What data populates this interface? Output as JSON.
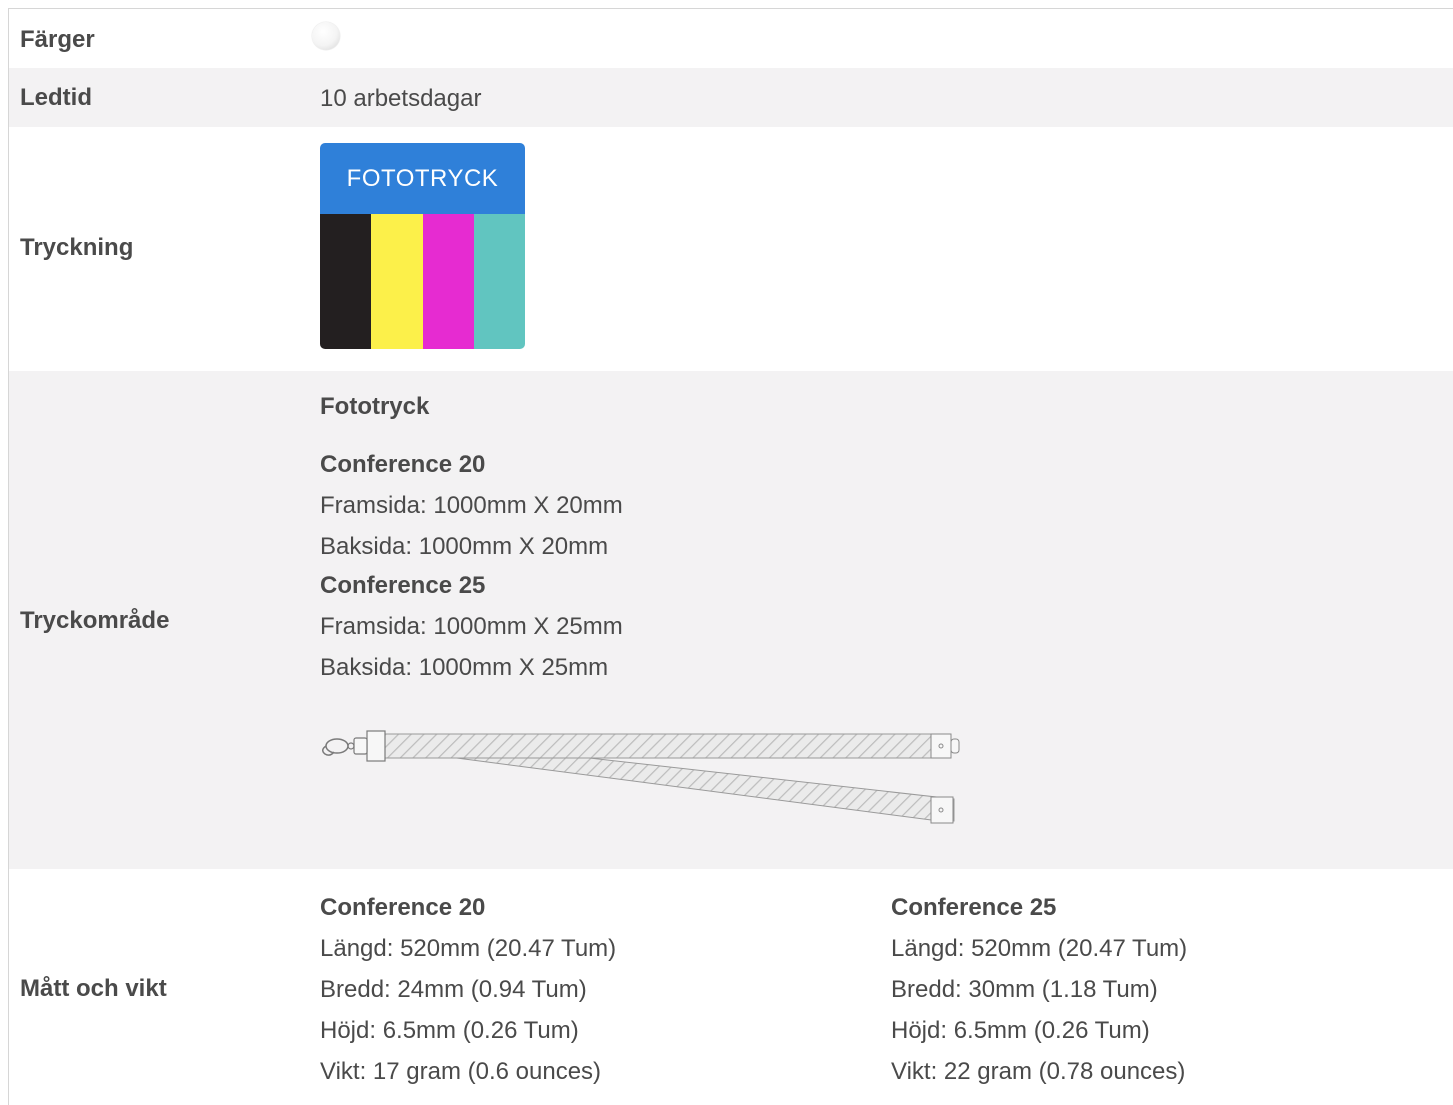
{
  "rows": {
    "colors": {
      "label": "Färger",
      "swatch_color": "#f4f4f4"
    },
    "lead_time": {
      "label": "Ledtid",
      "value": "10 arbetsdagar"
    },
    "printing": {
      "label": "Tryckning",
      "badge_title": "FOTOTRYCK",
      "badge_header_color": "#2f80d9",
      "bar_colors": [
        "#231f20",
        "#fcf04a",
        "#e62bd1",
        "#61c5c0"
      ]
    },
    "print_area": {
      "label": "Tryckområde",
      "method": "Fototryck",
      "models": [
        {
          "name": "Conference 20",
          "front": "Framsida: 1000mm X 20mm",
          "back": "Baksida: 1000mm X 20mm"
        },
        {
          "name": "Conference 25",
          "front": "Framsida: 1000mm X 25mm",
          "back": "Baksida: 1000mm X 25mm"
        }
      ],
      "image": "lanyard-illustration"
    },
    "dimensions": {
      "label": "Mått och vikt",
      "models": [
        {
          "name": "Conference 20",
          "length": "Längd: 520mm (20.47 Tum)",
          "width": "Bredd: 24mm (0.94 Tum)",
          "height": "Höjd: 6.5mm (0.26 Tum)",
          "weight": "Vikt: 17 gram (0.6 ounces)"
        },
        {
          "name": "Conference 25",
          "length": "Längd: 520mm (20.47 Tum)",
          "width": "Bredd: 30mm (1.18 Tum)",
          "height": "Höjd: 6.5mm (0.26 Tum)",
          "weight": "Vikt: 22 gram (0.78 ounces)"
        }
      ]
    }
  }
}
